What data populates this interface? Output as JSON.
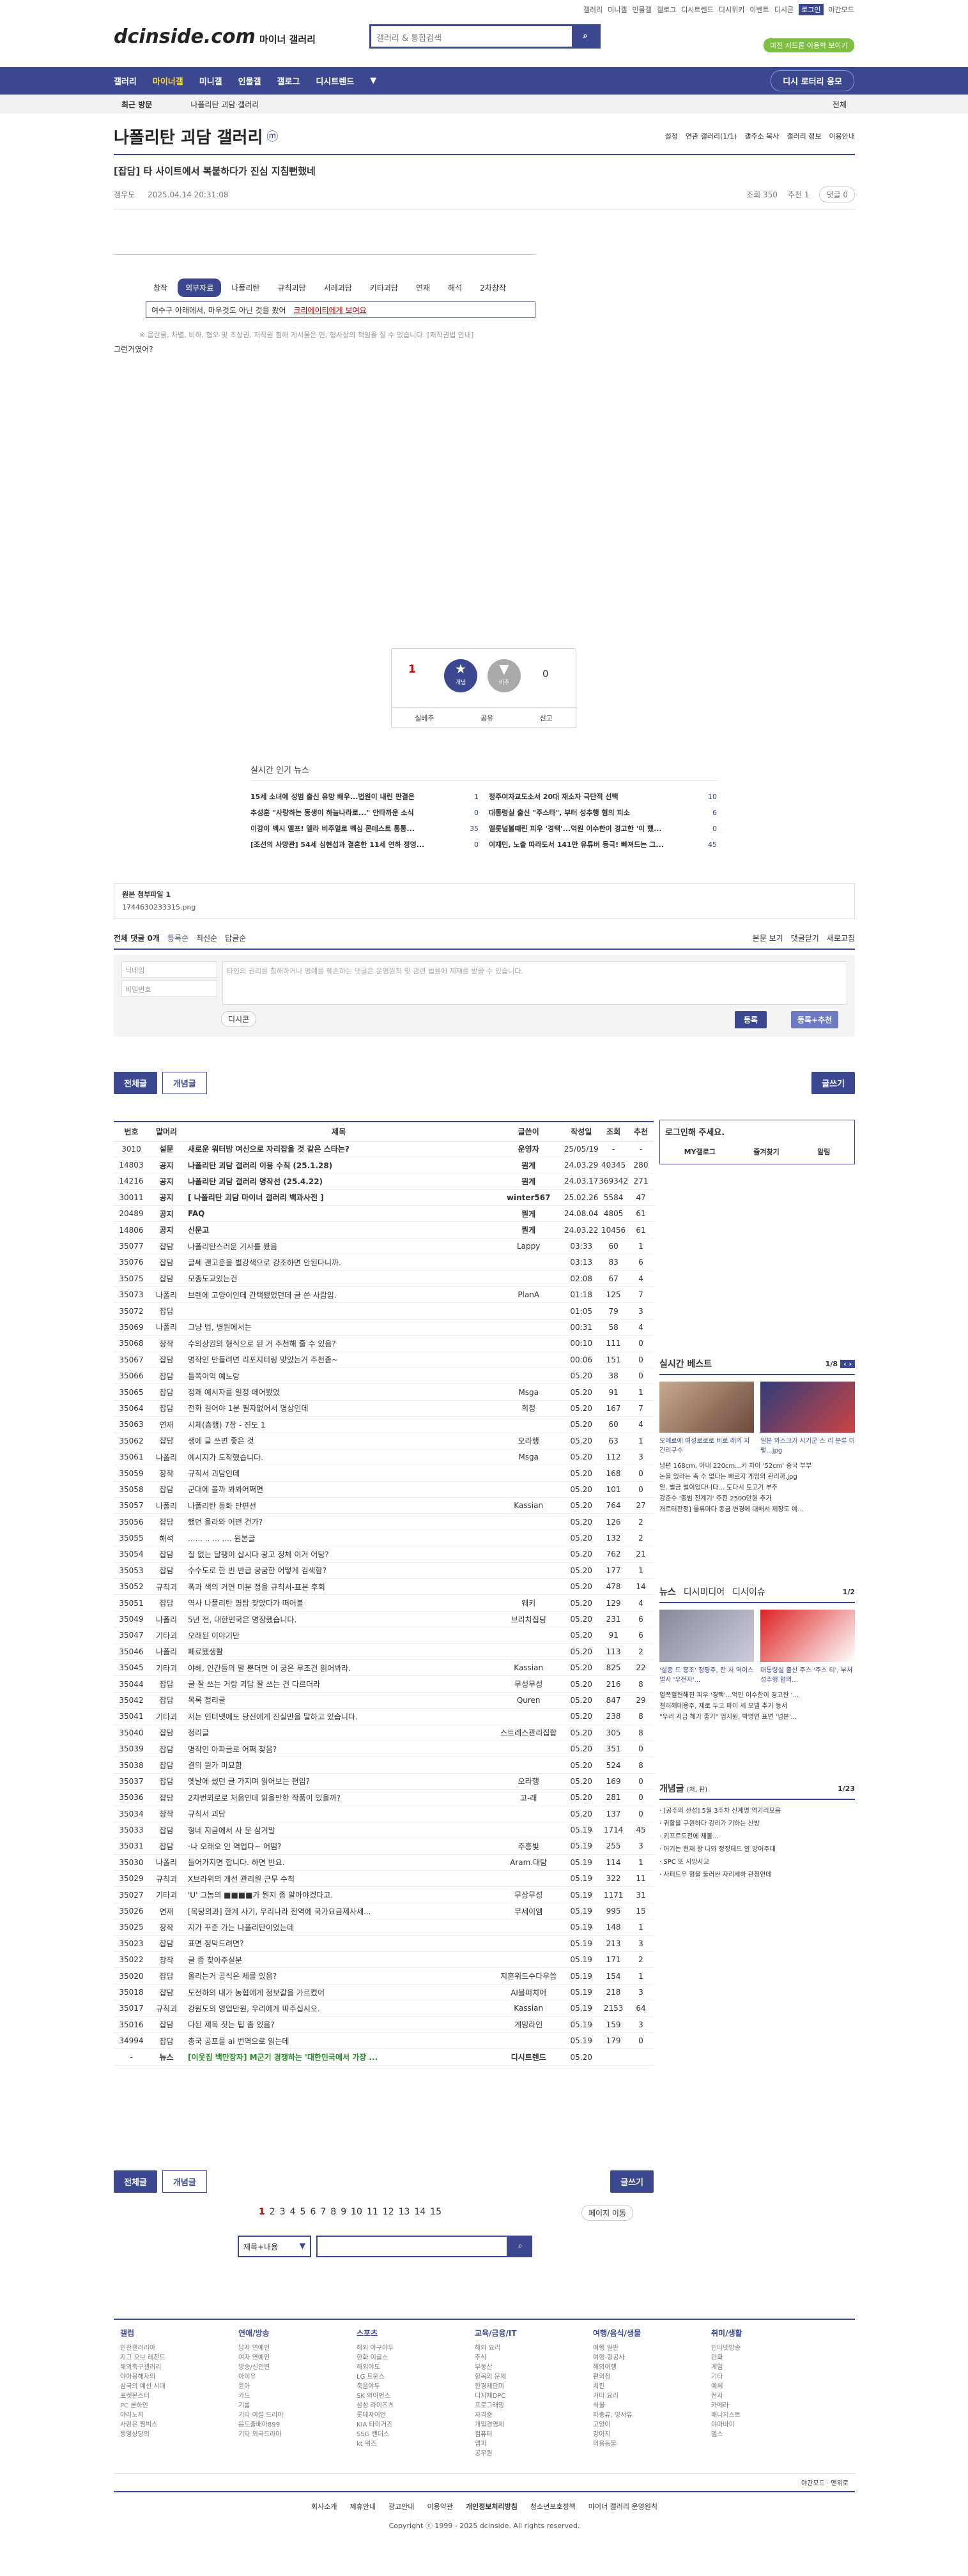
{
  "top": {
    "links": [
      "갤러리",
      "미니갤",
      "인물갤",
      "갤로그",
      "디시트렌드",
      "디시위키",
      "이벤트",
      "디시콘"
    ],
    "login": "로그인",
    "dark": "야간모드"
  },
  "logo": {
    "name": "dcinside.com",
    "sub": "마이너 갤러리"
  },
  "search": {
    "placeholder": "갤러리 & 통합검색"
  },
  "green_btn": "마진 지드론 이용학 보아기",
  "nav": {
    "items": [
      "갤러리",
      "마이너갤",
      "미니갤",
      "인물갤",
      "갤로그",
      "디시트렌드"
    ],
    "right": "디시 로터리 응모"
  },
  "crumb": {
    "label": "최근 방문",
    "item": "나폴리탄 괴담 갤러리",
    "all": "전체"
  },
  "gallery": {
    "title": "나폴리탄 괴담 갤러리",
    "badge": "ⓜ",
    "tools": [
      "설정",
      "연관 갤러리(1/1)",
      "갤주소 복사",
      "갤러리 정보",
      "이용안내"
    ]
  },
  "post": {
    "title": "[잡담] 타 사이트에서 복붙하다가 진심 지침뻔했네",
    "author": "갱우도",
    "date": "2025.04.14 20:31:08",
    "views": "조회 350",
    "rec": "추천 1",
    "comments": "댓글 0"
  },
  "subtabs": [
    "창작",
    "외부자료",
    "나폴리탄",
    "규칙괴담",
    "서레괴담",
    "키타괴담",
    "연재",
    "해석",
    "2차창작",
    "기타"
  ],
  "notice_box": "여수구 아래에서, 마우것도 아닌 것을 봤어",
  "notice_link": "크리에이티에게 보여요",
  "warning": "※ 음란물, 차별, 비하, 혐오 및 초상권, 저작권 침해 게시물은 민, 형사상의 책임을 질 수 있습니다. [저작권법 안내]",
  "body_text": "그런거였어?",
  "vote": {
    "up": "1",
    "down": "0",
    "up_label": "개념",
    "down_label": "비추",
    "actions": [
      "실베추",
      "공유",
      "신고"
    ]
  },
  "news": {
    "title": "실시간 인기 뉴스",
    "left": [
      "15세 소녀에 성범 출신 유망 배우...법원이 내린 판결은",
      "추성훈 \"사랑하는 동생이 하늘나라로...\" 안타까운 소식",
      "이강이 벡시 엘프! 엘라 비주얼로 벡심 콘테스트 통통...",
      "[조선의 사망관] 54세 심현섭과 결혼한 11세 연하 정영..."
    ],
    "left_n": [
      "1",
      "0",
      "35",
      "0"
    ],
    "right": [
      "정주여자교도소서 20대 재소자 극단적 선택",
      "대통령실 출신 \"주스타\", 부터 성추행 혐의 피소",
      "엘롯널볼때린 피우 '경택'...억원 이수한이 경고한 '이 했...",
      "이재민, 노출 따라도서 141만 유튜버 등극! 빠져드는 그..."
    ],
    "right_n": [
      "10",
      "6",
      "0",
      "45"
    ]
  },
  "attach": {
    "label": "원본 첨부파일 1",
    "file": "1744630233315.png"
  },
  "cmt": {
    "total": "전체 댓글 0개",
    "sort": [
      "등록순",
      "최신순",
      "답글순"
    ],
    "view": "본문 보기",
    "close": "댓글닫기",
    "refresh": "새로고침",
    "nick": "닉네임",
    "pw": "비밀번호",
    "placeholder": "타인의 권리를 침해하거나 명예를 훼손하는 댓글은 운영원칙 및 관련 법률에 제재를 받을 수 있습니다.",
    "dccon": "디시콘",
    "submit": "등록",
    "submit2": "등록+추천"
  },
  "btns": {
    "all": "전체글",
    "concept": "개념글",
    "write": "글쓰기"
  },
  "table": {
    "headers": [
      "번호",
      "말머리",
      "제목",
      "글쓴이",
      "작성일",
      "조회",
      "추천"
    ],
    "rows": [
      [
        "3010",
        "설문",
        "새로운 워터밤 여신으로 자리잡을 것 같은 스타는?",
        "운영자",
        "25/05/19",
        "-",
        "-"
      ],
      [
        "14803",
        "공지",
        "나폴리탄 괴담 갤러리 이용 수칙 (25.1.28)",
        "뭔게",
        "24.03.29",
        "40345",
        "280"
      ],
      [
        "14216",
        "공지",
        "나폴리탄 괴담 갤러리 명작선 (25.4.22)",
        "뭔게",
        "24.03.17",
        "369342",
        "271"
      ],
      [
        "30011",
        "공지",
        "[ 나폴리탄 괴담 마이너 갤러리 백과사전 ]",
        "winter567",
        "25.02.26",
        "5584",
        "47"
      ],
      [
        "20489",
        "공지",
        "FAQ",
        "뭔게",
        "24.08.04",
        "4805",
        "61"
      ],
      [
        "14806",
        "공지",
        "신문고",
        "뭔게",
        "24.03.22",
        "10456",
        "61"
      ],
      [
        "35077",
        "잡담",
        "나폴리탄스러운 기사를 봤음",
        "Lappy",
        "03:33",
        "60",
        "1"
      ],
      [
        "35076",
        "잡담",
        "글쎄 괜고운을 별강색으로 강조하면 안된다니까.",
        "",
        "03:13",
        "83",
        "6"
      ],
      [
        "35075",
        "잡담",
        "모종도교있는건",
        "",
        "02:08",
        "67",
        "4"
      ],
      [
        "35073",
        "나폴리",
        "브렌에 고양이인데 간택됐었던데 글 쓴 사람임.",
        "PlanA",
        "01:18",
        "125",
        "7"
      ],
      [
        "35072",
        "잡담",
        "",
        "",
        "01:05",
        "79",
        "3"
      ],
      [
        "35069",
        "나폴리",
        "그냥 법, 병원에서는",
        "",
        "00:31",
        "58",
        "4"
      ],
      [
        "35068",
        "창작",
        "수의상권의 형식으로 된 거 추천해 줄 수 있음?",
        "",
        "00:10",
        "111",
        "0"
      ],
      [
        "35067",
        "잡담",
        "명작인 만들려면 리포지터링 맞았는거 추천좀~",
        "",
        "00:06",
        "151",
        "0"
      ],
      [
        "35066",
        "잡담",
        "틀쪽이익 예노랑",
        "",
        "05.20",
        "38",
        "0"
      ],
      [
        "35065",
        "잡담",
        "정쾌 예시자를 일정 떼어봤었",
        "Msga",
        "05.20",
        "91",
        "1"
      ],
      [
        "35064",
        "잡담",
        "전화 길어야 1분 필자없어서 명상인데",
        "희정",
        "05.20",
        "167",
        "7"
      ],
      [
        "35063",
        "연재",
        "시체(층행) 7장 - 진도 1",
        "",
        "05.20",
        "60",
        "4"
      ],
      [
        "35062",
        "잡담",
        "생에 글 쓰면 좋은 것",
        "오라행",
        "05.20",
        "63",
        "1"
      ],
      [
        "35061",
        "나폴리",
        "예시지가 도착했습니다.",
        "Msga",
        "05.20",
        "112",
        "3"
      ],
      [
        "35059",
        "창작",
        "규칙서 괴담인데",
        "",
        "05.20",
        "168",
        "0"
      ],
      [
        "35058",
        "잡담",
        "군대에 볼까 봐봐어쩌면",
        "",
        "05.20",
        "101",
        "0"
      ],
      [
        "35057",
        "나폴리",
        "나폴리탄 동화 단편선",
        "Kassian",
        "05.20",
        "764",
        "27"
      ],
      [
        "35056",
        "잡담",
        "했던 올라와 어떤 건가?",
        "",
        "05.20",
        "126",
        "2"
      ],
      [
        "35055",
        "해석",
        "...... .. ... .... 원본글",
        "",
        "05.20",
        "132",
        "2"
      ],
      [
        "35054",
        "잡담",
        "질 없는 달팽이 삽시다 광고 정체 이거 어탕?",
        "",
        "05.20",
        "762",
        "21"
      ],
      [
        "35053",
        "잡담",
        "수수도로 한 번 반급 궁굼한 어떻게 검색함?",
        "",
        "05.20",
        "177",
        "1"
      ],
      [
        "35052",
        "규칙괴",
        "폭과 색의 거연 미분 정을 규칙서-표본 후회",
        "",
        "05.20",
        "478",
        "14"
      ],
      [
        "35051",
        "잡담",
        "역사 나폴리탄 명탐 찾았다가 떠어볼",
        "웨키",
        "05.20",
        "129",
        "4"
      ],
      [
        "35049",
        "나폴리",
        "5년 전, 대한민국은 명장했습니다.",
        "브리치집딩",
        "05.20",
        "231",
        "6"
      ],
      [
        "35047",
        "기타괴",
        "오래된 이야기만",
        "",
        "05.20",
        "91",
        "6"
      ],
      [
        "35046",
        "나폴리",
        "폐료됐생활",
        "",
        "05.20",
        "113",
        "2"
      ],
      [
        "35045",
        "기타괴",
        "야해, 인간들의 말 뿐더면 이 궁은 무조건 읽어봐라.",
        "Kassian",
        "05.20",
        "825",
        "22"
      ],
      [
        "35044",
        "잡담",
        "글 잘 쓰는 거랑 괴담 잘 쓰는 건 다르더라",
        "무성무성",
        "05.20",
        "216",
        "8"
      ],
      [
        "35042",
        "잡담",
        "목록 정리글",
        "Quren",
        "05.20",
        "847",
        "29"
      ],
      [
        "35041",
        "기타괴",
        "저는 인터넷에도 당신에게 진실만을 말하고 있습니다.",
        "",
        "05.20",
        "238",
        "8"
      ],
      [
        "35040",
        "잡담",
        "정리글",
        "스트레스관리집합",
        "05.20",
        "305",
        "8"
      ],
      [
        "35039",
        "잡담",
        "명작인 아파글로 어쩌 찾음?",
        "",
        "05.20",
        "351",
        "0"
      ],
      [
        "35038",
        "잡담",
        "결의 뭔가 미묘함",
        "",
        "05.20",
        "524",
        "8"
      ],
      [
        "35037",
        "잡담",
        "옛날에 썼던 글 가지며 읽어보는 편임?",
        "오라행",
        "05.20",
        "169",
        "0"
      ],
      [
        "35036",
        "잡담",
        "2차번외로로 처음인데 읽을만한 작품이 있을까?",
        "고-래",
        "05.20",
        "281",
        "0"
      ],
      [
        "35034",
        "창작",
        "규칙서 괴담",
        "",
        "05.20",
        "137",
        "0"
      ],
      [
        "35033",
        "잡담",
        "형네 지금에서 사 문 삼겨말",
        "",
        "05.19",
        "1714",
        "45"
      ],
      [
        "35031",
        "잡담",
        "-나 오래오 인 역업다~ 어떰?",
        "주흥빛",
        "05.19",
        "255",
        "3"
      ],
      [
        "35030",
        "나폴리",
        "들어가지면 합니다. 하면 반요.",
        "Aram.대탐",
        "05.19",
        "114",
        "1"
      ],
      [
        "35029",
        "규칙괴",
        "X브라위의 개선 관리원 근무 수칙",
        "",
        "05.19",
        "322",
        "11"
      ],
      [
        "35027",
        "기타괴",
        "'U' 그놈의 ■■■■가 뭔지 좀 알아야겠다고.",
        "무상무성",
        "05.19",
        "1171",
        "31"
      ],
      [
        "35026",
        "연재",
        "[목탕의과] 한계 사기, 우리나라 전역에 국가요금제사세...",
        "무세이엠",
        "05.19",
        "995",
        "15"
      ],
      [
        "35025",
        "창작",
        "지가 꾸준 가는 나폴리탄이었는데",
        "",
        "05.19",
        "148",
        "1"
      ],
      [
        "35023",
        "잡담",
        "표면 정막드려면?",
        "",
        "05.19",
        "213",
        "3"
      ],
      [
        "35022",
        "창작",
        "글 좀 찾아주실분",
        "",
        "05.19",
        "171",
        "2"
      ],
      [
        "35020",
        "잡담",
        "올리는거 공식은 체를 있음?",
        "지혼위드수다우씀",
        "05.19",
        "154",
        "1"
      ],
      [
        "35018",
        "잡담",
        "도전하의 내가 농협에게 정보갈을 가르켰어",
        "AI블퍼치어",
        "05.19",
        "218",
        "3"
      ],
      [
        "35017",
        "규칙괴",
        "강원도의 영업만원, 우리에게 따주십시오.",
        "Kassian",
        "05.19",
        "2153",
        "64"
      ],
      [
        "35016",
        "잡담",
        "다된 제목 짓는 팁 좀 있음?",
        "게밍라인",
        "05.19",
        "159",
        "3"
      ],
      [
        "34994",
        "잡담",
        "총국 공포물 ai 번역으로 읽는데",
        "",
        "05.19",
        "179",
        "0"
      ],
      [
        "-",
        "뉴스",
        "[이웃집 백만장자] M군기 경쟁하는 '대한민국에서 가장 ...",
        "디시트렌드",
        "05.20",
        "",
        ""
      ]
    ]
  },
  "pages": [
    "1",
    "2",
    "3",
    "4",
    "5",
    "6",
    "7",
    "8",
    "9",
    "10",
    "11",
    "12",
    "13",
    "14",
    "15"
  ],
  "page_move": "페이지 이동",
  "search2": {
    "select": "제목+내용"
  },
  "side": {
    "login_title": "로그인해 주세요.",
    "login_links": [
      "MY갤로그",
      "즐겨찾기",
      "알림"
    ],
    "best": "실시간 베스트",
    "best_page": "1/8",
    "best_caps": [
      "오메로에 여성로로로 비로 래의 자긴리구수",
      "일본 와스크가 시기군 스 리 분류 이렇...jpg"
    ],
    "best_list": [
      "남편 168cm, 아내 220cm...키 차이 '52cm' 중국 부부",
      "논을 있라는 촉 수 없다는 빠르지 게임의 관리까.jpg",
      "얻. 벌금 벌이었다니다... 도다시 토고기 부추",
      "강춘수 '총범 전계기' 주전 2500만원 추가",
      "개르터판정] 물류마다 종금 변경에 대해서 제장도 예..."
    ],
    "news_tabs": [
      "뉴스",
      "디시미디어",
      "디시이슈"
    ],
    "news_page": "1/2",
    "news_caps": [
      "'설종 드 흥조' 정평주, 잔 치 역이스 멀사 '우전자'...",
      "대통령실 출신 주스 '주스 티', 부처 성추행 혐의..."
    ],
    "news_list": [
      "얼폭헐헌해진 피우 '경택'...억민 이수한이 경고한 '...",
      "갤러해데용주, 제로 두고 파이 세 모델 추가 등서",
      "\"우리 지금 헤가 좋기\" 엄지원, 박명연 표면 '넘본'..."
    ],
    "concept": "개념글",
    "concept_sub": "(처, 판)",
    "concept_page": "1/23",
    "concept_list": [
      "[공주의 산성] 5월 3주차 신계명 역기리모음",
      "귀할을 구원하다 강리가 기하는 산방",
      "키프르도전에 제볼...",
      "어기는 현재 왕 나와 정정데드 알 방어주대",
      "SPC 또 사망사고",
      "사퍼드우 형을 둘러싼 자리세하 관정인데"
    ]
  },
  "footer": {
    "cols": [
      {
        "h": "갤럽",
        "items": [
          "인천갤러리아",
          "지그 오브 레전드",
          "해외축구갤러리",
          "야아몽해자의",
          "삼국의 예선 시대",
          "포켓몬스터",
          "PC 론하인",
          "야라노지",
          "사랑은 짬빅스",
          "동영상당의"
        ]
      },
      {
        "h": "연애/방송",
        "items": [
          "남자 연예인",
          "여자 연예인",
          "방송/신인변",
          "아이유",
          "윤아",
          "카드",
          "기롭",
          "기타 여설 드라마",
          "음드출배아899",
          "기타 외국드라마"
        ]
      },
      {
        "h": "스포츠",
        "items": [
          "해외 야구야두",
          "한화 이글스",
          "해외야도",
          "LG 트윈스",
          "축음야두",
          "SK 와이번스",
          "삼성 라이즈츠",
          "롯데자이언",
          "KIA 타이거즈",
          "SSG 랜더스",
          "kt 위즈"
        ]
      },
      {
        "h": "교육/금융/IT",
        "items": [
          "해외 요리",
          "주식",
          "부동산",
          "항목의 문제",
          "한경제단미",
          "디지체DPC",
          "프로그래밍",
          "자격증",
          "개밀경영제",
          "컴퓨터",
          "앱피",
          "공무원"
        ]
      },
      {
        "h": "여행/음식/생물",
        "items": [
          "여행 일반",
          "여행-항공사",
          "해외여행",
          "편의점",
          "치킨",
          "기타 요리",
          "식물",
          "파충류, 양서류",
          "고양이",
          "강아지",
          "의용동물"
        ]
      },
      {
        "h": "취미/생활",
        "items": [
          "인터넷방송",
          "만화",
          "게임",
          "기타",
          "예체",
          "전자",
          "카메라",
          "매니지스트",
          "야마바이",
          "엘스"
        ]
      }
    ],
    "bottom": [
      "회사소개",
      "제휴안내",
      "광고안내",
      "이용약관",
      "개인정보처리방침",
      "청소년보호정책",
      "마이너 갤러리 운영원칙"
    ],
    "copy": "Copyright ⓒ 1999 - 2025 dcinside. All rights reserved.",
    "right": [
      "야간모드",
      "맨위로"
    ]
  },
  "colors": {
    "brand": "#3b4890",
    "accent": "#ffd43b",
    "green": "#7fbf3f"
  }
}
